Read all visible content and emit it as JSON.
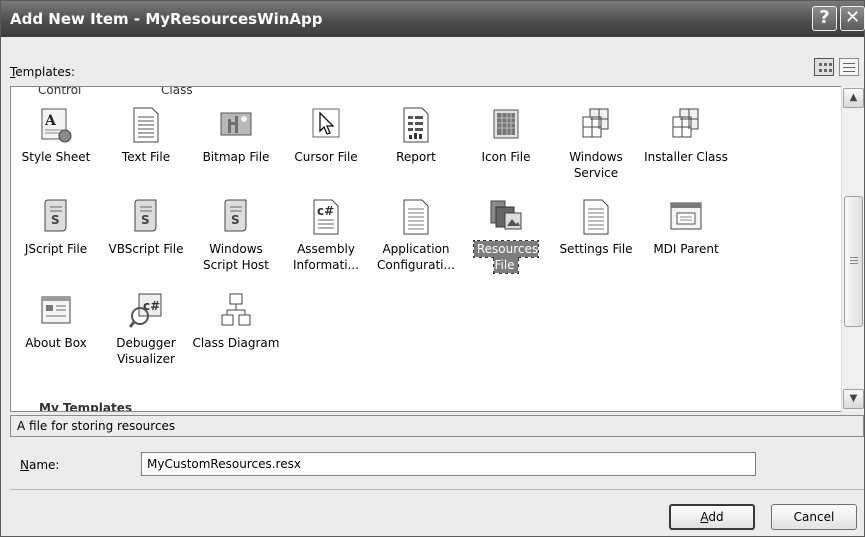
{
  "window": {
    "title": "Add New Item - MyResourcesWinApp",
    "help_glyph": "?",
    "close_glyph": "✕"
  },
  "templates": {
    "label_accel": "T",
    "label_rest": "emplates:",
    "partial_top": [
      "Control",
      "Class"
    ],
    "partial_group_heading": "My Templates",
    "items": [
      {
        "label": "Style Sheet",
        "icon": "style-sheet-icon"
      },
      {
        "label": "Text File",
        "icon": "text-file-icon"
      },
      {
        "label": "Bitmap File",
        "icon": "bitmap-file-icon"
      },
      {
        "label": "Cursor File",
        "icon": "cursor-file-icon"
      },
      {
        "label": "Report",
        "icon": "report-icon"
      },
      {
        "label": "Icon File",
        "icon": "icon-file-icon"
      },
      {
        "label": "Windows Service",
        "icon": "windows-service-icon"
      },
      {
        "label": "Installer Class",
        "icon": "installer-class-icon"
      },
      {
        "label": "JScript File",
        "icon": "jscript-file-icon"
      },
      {
        "label": "VBScript File",
        "icon": "vbscript-file-icon"
      },
      {
        "label": "Windows Script Host",
        "icon": "windows-script-host-icon"
      },
      {
        "label": "Assembly Informati...",
        "icon": "assembly-info-icon"
      },
      {
        "label": "Application Configurati...",
        "icon": "app-config-icon"
      },
      {
        "label": "Resources File",
        "icon": "resources-file-icon",
        "selected": true
      },
      {
        "label": "Settings File",
        "icon": "settings-file-icon"
      },
      {
        "label": "MDI Parent",
        "icon": "mdi-parent-icon"
      },
      {
        "label": "About Box",
        "icon": "about-box-icon"
      },
      {
        "label": "Debugger Visualizer",
        "icon": "debugger-visualizer-icon"
      },
      {
        "label": "Class Diagram",
        "icon": "class-diagram-icon"
      }
    ]
  },
  "description": "A file for storing resources",
  "name_field": {
    "label_accel": "N",
    "label_rest": "ame:",
    "value": "MyCustomResources.resx"
  },
  "buttons": {
    "add_accel": "A",
    "add_rest": "dd",
    "cancel": "Cancel"
  }
}
